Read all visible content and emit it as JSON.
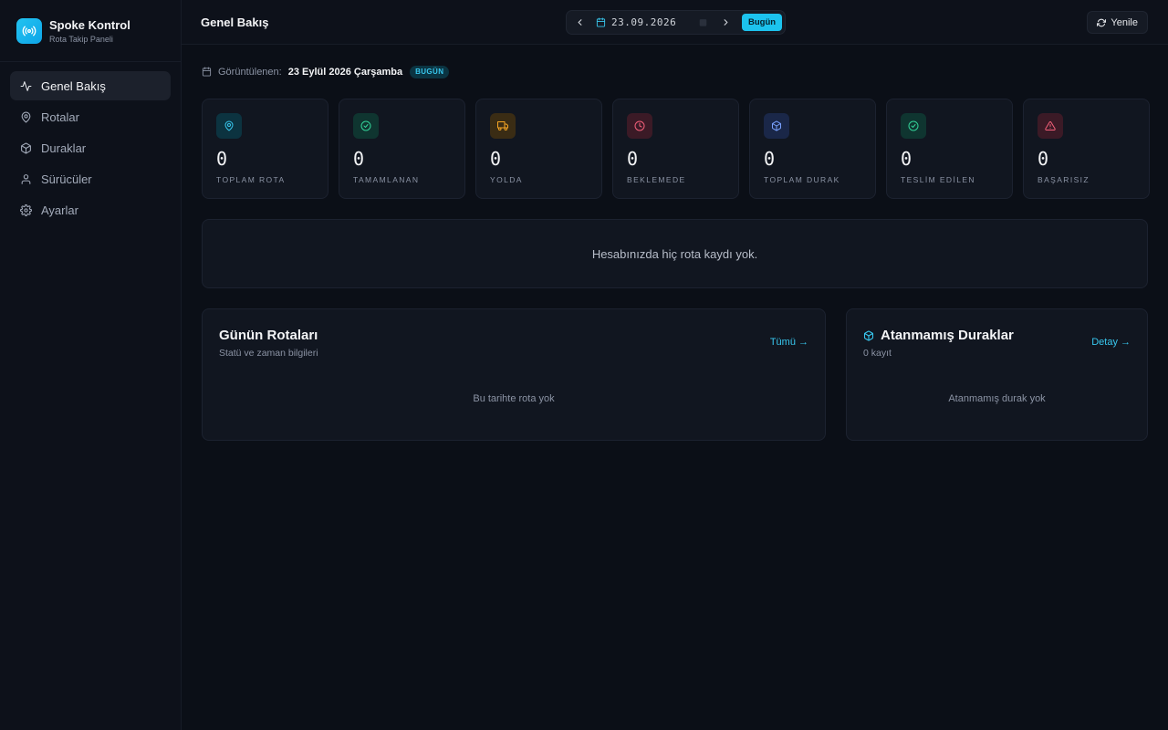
{
  "brand": {
    "name": "Spoke Kontrol",
    "subtitle": "Rota Takip Paneli"
  },
  "sidebar": {
    "items": [
      {
        "label": "Genel Bakış",
        "icon": "activity-icon",
        "active": true
      },
      {
        "label": "Rotalar",
        "icon": "map-pin-icon",
        "active": false
      },
      {
        "label": "Duraklar",
        "icon": "package-icon",
        "active": false
      },
      {
        "label": "Sürücüler",
        "icon": "user-icon",
        "active": false
      },
      {
        "label": "Ayarlar",
        "icon": "gear-icon",
        "active": false
      }
    ]
  },
  "header": {
    "title": "Genel Bakış",
    "date": "23.09.2026",
    "today_label": "Bugün",
    "refresh_label": "Yenile"
  },
  "viewing": {
    "label": "Görüntülenen:",
    "date": "23 Eylül 2026 Çarşamba",
    "badge": "BUGÜN"
  },
  "stats": [
    {
      "label": "TOPLAM ROTA",
      "value": "0",
      "icon": "map-pin-icon",
      "color": "#38c7ee"
    },
    {
      "label": "TAMAMLANAN",
      "value": "0",
      "icon": "check-circle-icon",
      "color": "#34d399"
    },
    {
      "label": "YOLDA",
      "value": "0",
      "icon": "truck-icon",
      "color": "#f5a524"
    },
    {
      "label": "BEKLEMEDE",
      "value": "0",
      "icon": "clock-icon",
      "color": "#f4607a"
    },
    {
      "label": "TOPLAM DURAK",
      "value": "0",
      "icon": "package-icon",
      "color": "#7aa2ff"
    },
    {
      "label": "TESLİM EDİLEN",
      "value": "0",
      "icon": "check-circle-icon",
      "color": "#34d399"
    },
    {
      "label": "BAŞARISIZ",
      "value": "0",
      "icon": "alert-triangle-icon",
      "color": "#f4607a"
    }
  ],
  "empty_banner": "Hesabınızda hiç rota kaydı yok.",
  "routes_panel": {
    "title": "Günün Rotaları",
    "subtitle": "Statü ve zaman bilgileri",
    "link": "Tümü →",
    "empty": "Bu tarihte rota yok"
  },
  "unassigned_panel": {
    "title": "Atanmamış Duraklar",
    "subtitle": "0 kayıt",
    "link": "Detay →",
    "empty": "Atanmamış durak yok"
  },
  "colors": {
    "accent": "#1cc3ee",
    "background": "#0b0f17",
    "card": "#111620"
  }
}
